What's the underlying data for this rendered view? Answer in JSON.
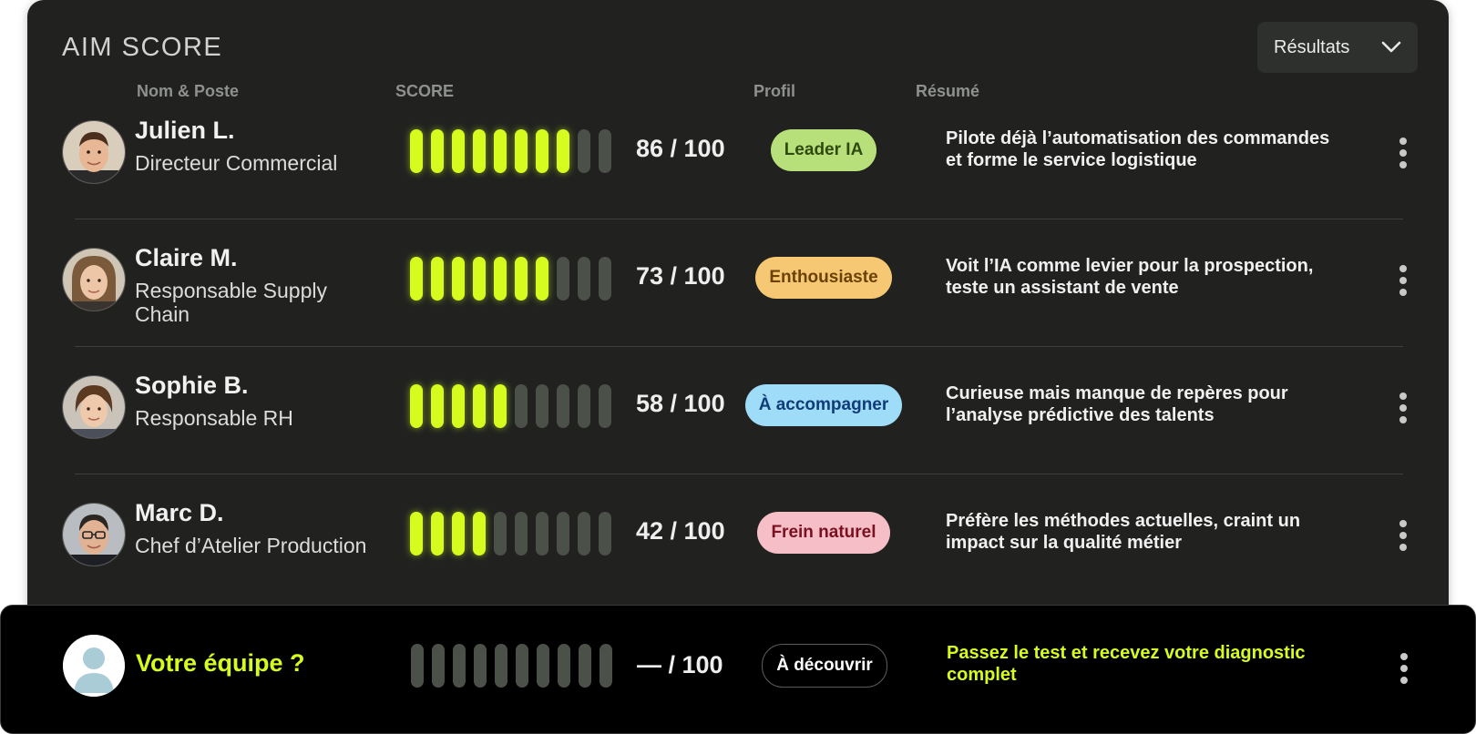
{
  "header": {
    "title": "AIM SCORE",
    "dropdown_label": "Résultats",
    "dropdown_icon": "chevron-down-icon"
  },
  "columns": {
    "name": "Nom & Poste",
    "score": "SCORE",
    "profile": "Profil",
    "summary": "Résumé"
  },
  "colors": {
    "background": "#212220",
    "bar_active": "#d6fb1f",
    "bar_inactive": "#4b5049",
    "footer_accent": "#d6fb1f"
  },
  "rows": [
    {
      "name": "Julien L.",
      "role": "Directeur Commercial",
      "score_text": "86 / 100",
      "score": 86,
      "bars_filled": 8,
      "bars_total": 10,
      "profile": "Leader IA",
      "profile_bg": "#b8e07a",
      "profile_color": "#2f4a10",
      "summary": "Pilote déjà l’automatisation des commandes et forme le service logistique"
    },
    {
      "name": "Claire M.",
      "role": "Responsable Supply Chain",
      "score_text": "73 / 100",
      "score": 73,
      "bars_filled": 7,
      "bars_total": 10,
      "profile": "Enthousiaste",
      "profile_bg": "#f7c873",
      "profile_color": "#6a4208",
      "summary": "Voit l’IA comme levier pour la prospection, teste un assistant de vente"
    },
    {
      "name": "Sophie B.",
      "role": "Responsable RH",
      "score_text": "58 / 100",
      "score": 58,
      "bars_filled": 5,
      "bars_total": 10,
      "profile": "À accompagner",
      "profile_bg": "#9fdcf7",
      "profile_color": "#123c78",
      "summary": "Curieuse mais manque de repères pour l’analyse prédictive des talents"
    },
    {
      "name": "Marc D.",
      "role": "Chef d’Atelier Production",
      "score_text": "42 / 100",
      "score": 42,
      "bars_filled": 4,
      "bars_total": 10,
      "profile": "Frein naturel",
      "profile_bg": "#f6bec7",
      "profile_color": "#7a1020",
      "summary": "Préfère les méthodes actuelles, craint un impact sur la qualité métier"
    }
  ],
  "footer": {
    "name": "Votre équipe ?",
    "score_text": "— / 100",
    "bars_filled": 0,
    "bars_total": 10,
    "profile": "À découvrir",
    "summary": "Passez le test et recevez votre diagnostic complet"
  }
}
